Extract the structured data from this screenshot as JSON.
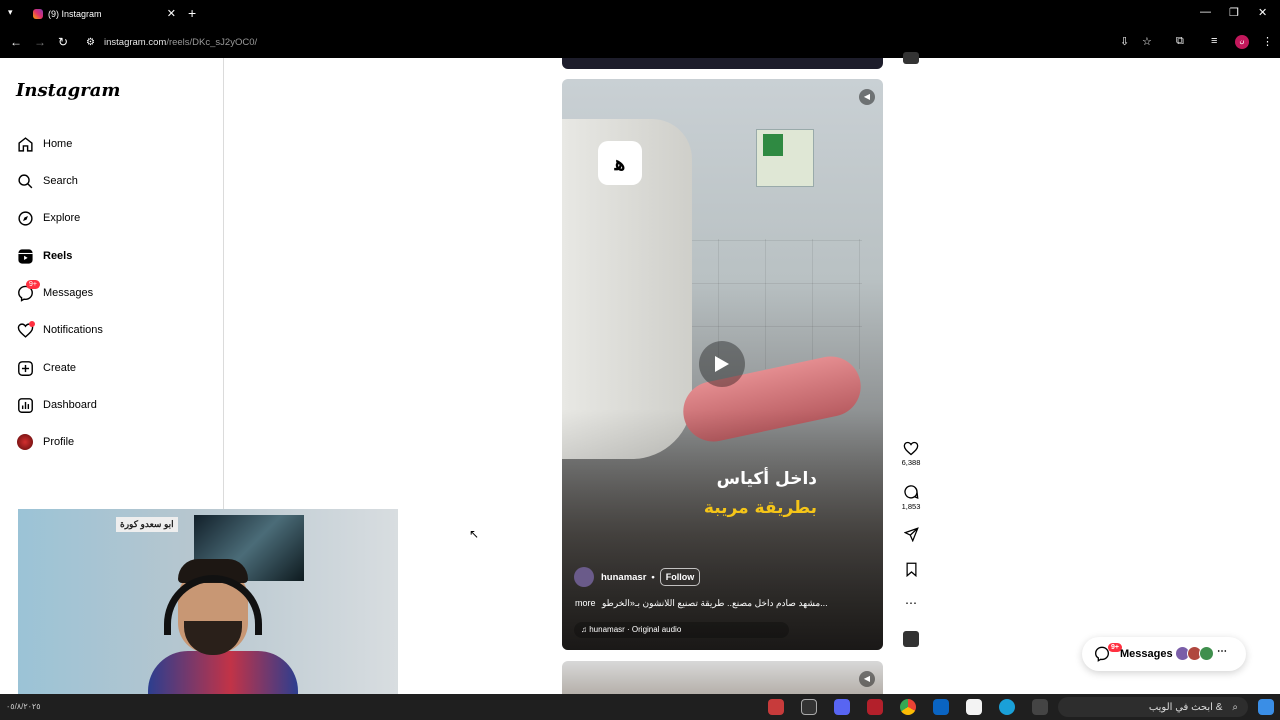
{
  "browser": {
    "tab_title": "(9) Instagram",
    "url_host": "instagram.com",
    "url_path": "/reels/DKc_sJ2yOC0/"
  },
  "sidebar": {
    "logo": "Instagram",
    "items": [
      {
        "label": "Home",
        "icon": "home-icon"
      },
      {
        "label": "Search",
        "icon": "search-icon"
      },
      {
        "label": "Explore",
        "icon": "compass-icon"
      },
      {
        "label": "Reels",
        "icon": "reels-icon",
        "active": true
      },
      {
        "label": "Messages",
        "icon": "messenger-icon",
        "badge": "9+"
      },
      {
        "label": "Notifications",
        "icon": "heart-icon",
        "dot": true
      },
      {
        "label": "Create",
        "icon": "plus-square-icon"
      },
      {
        "label": "Dashboard",
        "icon": "chart-icon"
      },
      {
        "label": "Profile",
        "icon": "avatar-icon"
      }
    ]
  },
  "reel": {
    "caption_line1": "داخل أكياس",
    "caption_line2": "بطريقة مريبة",
    "author": "hunamasr",
    "follow_label": "Follow",
    "description": "مشهد صادم داخل مصنع.. طريقة تصنيع اللانشون بـ«الخرطو...",
    "more_label": "more",
    "audio": "hunamasr · Original audio",
    "likes": "6,388",
    "comments": "1,853"
  },
  "messages_widget": {
    "label": "Messages",
    "badge": "9+"
  },
  "webcam_sign": "ابو سعدو كورة",
  "taskbar": {
    "search_placeholder": "ابحث في الويب &",
    "clock": "٠٥/٨/٢٠٢٥"
  },
  "colors": {
    "accent_badge": "#ff3040",
    "caption_yellow": "#f5c518",
    "browser_chrome": "#000000"
  }
}
